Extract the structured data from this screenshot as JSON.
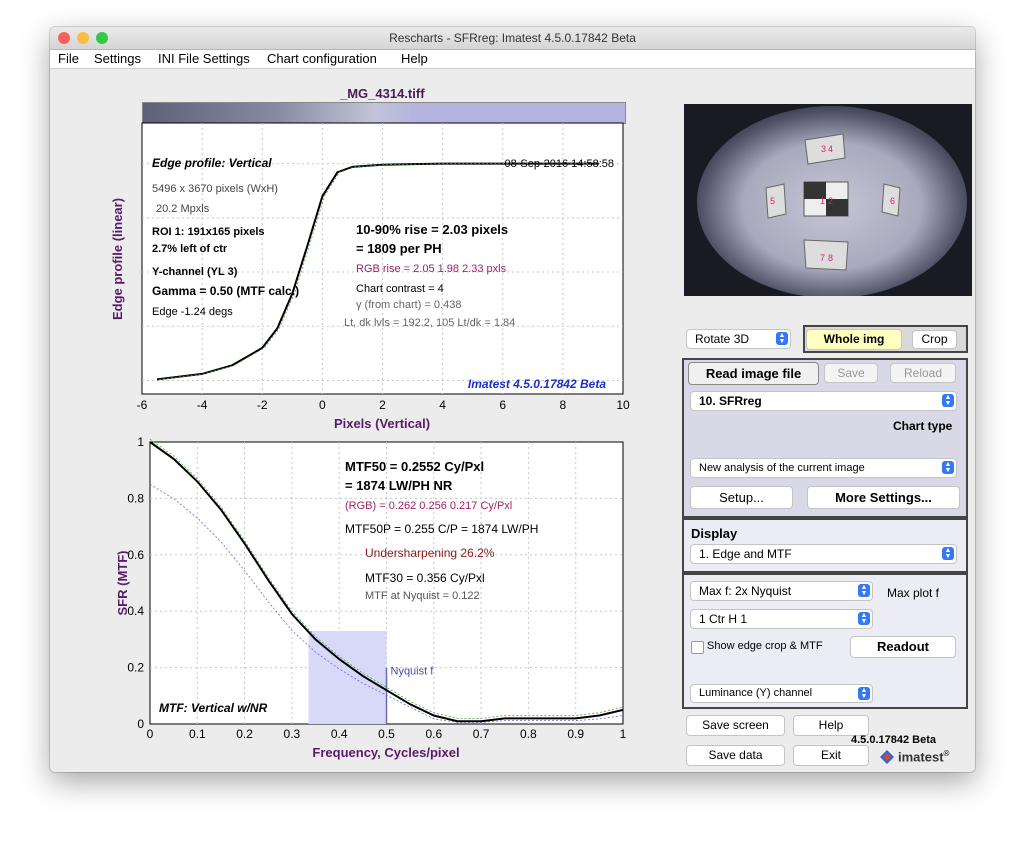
{
  "window": {
    "title": "Rescharts - SFRreg:  Imatest 4.5.0.17842 Beta"
  },
  "menu": [
    "File",
    "Settings",
    "INI File Settings",
    "Chart configuration",
    "Help"
  ],
  "file_name": "_MG_4314.tiff",
  "edge_plot": {
    "title": "Edge profile: Vertical",
    "timestamp": "08-Sep-2016 14:58:58",
    "info": [
      "5496 x 3670 pixels (WxH)",
      "20.2 Mpxls",
      "ROI 1:  191x165 pixels",
      "2.7% left of ctr",
      "Y-channel  (YL 3)",
      "Gamma = 0.50 (MTF calc.)",
      "Edge  -1.24 degs"
    ],
    "rise": "10-90% rise = 2.03 pixels",
    "per_ph": "=   1809 per PH",
    "rgb_rise": "RGB rise =   2.05    1.98    2.33 pxls",
    "contrast": "Chart contrast = 4",
    "gamma_chart": "γ (from chart) = 0.438",
    "levels": "Lt, dk lvls =  192.2,    105   Lt/dk =   1.84",
    "watermark": "Imatest 4.5.0.17842 Beta",
    "ylabel": "Edge profile (linear)",
    "xlabel": "Pixels (Vertical)",
    "xticks": [
      "-6",
      "-4",
      "-2",
      "0",
      "2",
      "4",
      "6",
      "8",
      "10"
    ]
  },
  "mtf_plot": {
    "mtf50": "MTF50 = 0.2552 Cy/Pxl",
    "lwph": "= 1874 LW/PH   NR",
    "rgb": "(RGB) = 0.262  0.256  0.217 Cy/Pxl",
    "mtf50p": "MTF50P = 0.255 C/P = 1874 LW/PH",
    "undersharp": "Undersharpening 26.2%",
    "mtf30": "MTF30 = 0.356 Cy/Pxl",
    "nyq": "MTF at Nyquist = 0.122",
    "nyq_label": "Nyquist f",
    "label": "MTF: Vertical w/NR",
    "ylabel": "SFR (MTF)",
    "xlabel": "Frequency, Cycles/pixel",
    "xticks": [
      "0",
      "0.1",
      "0.2",
      "0.3",
      "0.4",
      "0.5",
      "0.6",
      "0.7",
      "0.8",
      "0.9",
      "1"
    ],
    "yticks": [
      "0",
      "0.2",
      "0.4",
      "0.6",
      "0.8",
      "1"
    ]
  },
  "chart_data": [
    {
      "type": "line",
      "title": "Edge profile: Vertical",
      "xlabel": "Pixels (Vertical)",
      "ylabel": "Edge profile (linear)",
      "xlim": [
        -6,
        10
      ],
      "series": [
        {
          "x": [
            -5.5,
            -4,
            -3,
            -2,
            -1.5,
            -1,
            -0.5,
            0,
            0.5,
            1,
            1.5,
            2,
            3,
            4,
            6,
            8,
            9.2
          ],
          "y": [
            0.005,
            0.03,
            0.07,
            0.15,
            0.24,
            0.4,
            0.62,
            0.85,
            0.96,
            0.985,
            0.99,
            0.995,
            0.998,
            1.0,
            1.0,
            1.0,
            1.0
          ]
        }
      ]
    },
    {
      "type": "line",
      "xlabel": "Frequency, Cycles/pixel",
      "ylabel": "SFR (MTF)",
      "xlim": [
        0,
        1
      ],
      "ylim": [
        0,
        1
      ],
      "series": [
        {
          "x": [
            0,
            0.05,
            0.1,
            0.15,
            0.2,
            0.25,
            0.3,
            0.35,
            0.4,
            0.45,
            0.5,
            0.55,
            0.6,
            0.65,
            0.7,
            0.75,
            0.8,
            0.85,
            0.9,
            0.95,
            1.0
          ],
          "y": [
            1.0,
            0.94,
            0.86,
            0.76,
            0.64,
            0.51,
            0.39,
            0.3,
            0.23,
            0.17,
            0.12,
            0.07,
            0.03,
            0.01,
            0.01,
            0.02,
            0.02,
            0.02,
            0.02,
            0.03,
            0.05
          ]
        }
      ]
    }
  ],
  "controls": {
    "rotate": "Rotate 3D",
    "whole_img": "Whole img",
    "crop": "Crop",
    "read_image": "Read image file",
    "save": "Save",
    "reload": "Reload",
    "chart_select": "10. SFRreg",
    "chart_type": "Chart type",
    "analysis": "New analysis of the current image",
    "setup": "Setup...",
    "more_settings": "More Settings...",
    "display_label": "Display",
    "display_select": "1. Edge and MTF",
    "maxf_select": "Max f:   2x Nyquist",
    "maxplot": "Max plot f",
    "roi_select": "1 Ctr  H  1",
    "show_edge": "Show edge crop & MTF",
    "readout": "Readout",
    "channel_select": "Luminance (Y) channel",
    "save_screen": "Save screen",
    "help": "Help",
    "save_data": "Save data",
    "exit": "Exit",
    "version": "4.5.0.17842 Beta",
    "brand": "imatest",
    "reg": "®"
  },
  "thumbnail": {
    "labels": [
      "3",
      "4",
      "5",
      "1",
      "2",
      "6",
      "7",
      "8"
    ]
  }
}
